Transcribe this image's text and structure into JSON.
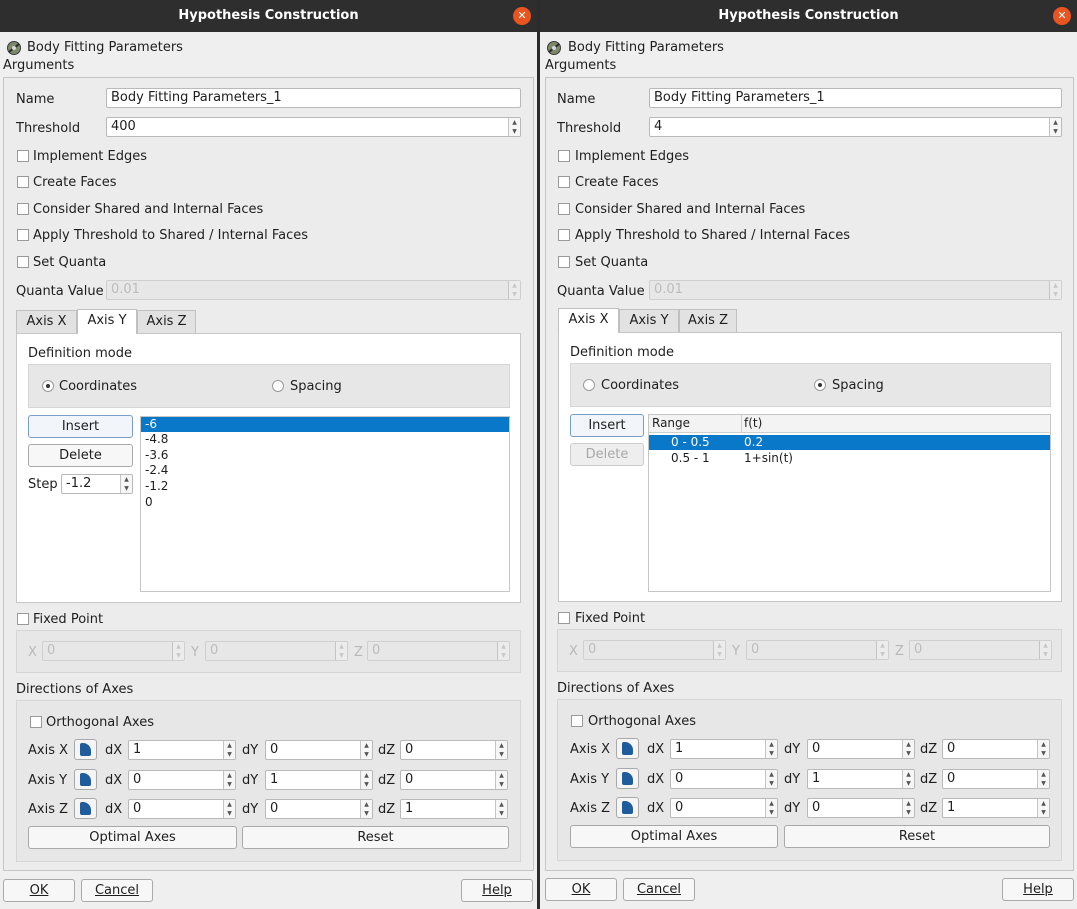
{
  "dialog_title": "Hypothesis Construction",
  "close_glyph": "✕",
  "header_label": "Body Fitting Parameters",
  "arguments_label": "Arguments",
  "name_label": "Name",
  "threshold_label": "Threshold",
  "implement_edges_label": "Implement Edges",
  "create_faces_label": "Create Faces",
  "consider_shared_label": "Consider Shared and Internal Faces",
  "apply_threshold_label": "Apply Threshold to Shared / Internal Faces",
  "set_quanta_label": "Set Quanta",
  "quanta_value_label": "Quanta Value",
  "tabs": [
    "Axis X",
    "Axis Y",
    "Axis Z"
  ],
  "definition_mode_label": "Definition mode",
  "coordinates_label": "Coordinates",
  "spacing_label": "Spacing",
  "insert_label": "Insert",
  "delete_label": "Delete",
  "step_label": "Step",
  "fixed_point_label": "Fixed Point",
  "x_label": "X",
  "y_label": "Y",
  "z_label": "Z",
  "directions_label": "Directions of Axes",
  "orthogonal_label": "Orthogonal Axes",
  "axis_rows": [
    "Axis X",
    "Axis Y",
    "Axis Z"
  ],
  "dx_label": "dX",
  "dy_label": "dY",
  "dz_label": "dZ",
  "optimal_axes_label": "Optimal Axes",
  "reset_label": "Reset",
  "ok_label": "OK",
  "cancel_label": "Cancel",
  "help_label": "Help",
  "left": {
    "name_value": "Body Fitting Parameters_1",
    "threshold_value": "400",
    "quanta_value": "0.01",
    "active_tab": "Axis Y",
    "definition_mode": "Coordinates",
    "step_value": "-1.2",
    "coordinates": [
      "-6",
      "-4.8",
      "-3.6",
      "-2.4",
      "-1.2",
      "0"
    ],
    "fixed_point": {
      "x": "0",
      "y": "0",
      "z": "0"
    },
    "axes": [
      {
        "dx": "1",
        "dy": "0",
        "dz": "0"
      },
      {
        "dx": "0",
        "dy": "1",
        "dz": "0"
      },
      {
        "dx": "0",
        "dy": "0",
        "dz": "1"
      }
    ]
  },
  "right": {
    "name_value": "Body Fitting Parameters_1",
    "threshold_value": "4",
    "quanta_value": "0.01",
    "active_tab": "Axis X",
    "definition_mode": "Spacing",
    "table_headers": [
      "Range",
      "f(t)"
    ],
    "spacing_rows": [
      {
        "range": "0 - 0.5",
        "ft": "0.2"
      },
      {
        "range": "0.5 - 1",
        "ft": "1+sin(t)"
      }
    ],
    "fixed_point": {
      "x": "0",
      "y": "0",
      "z": "0"
    },
    "axes": [
      {
        "dx": "1",
        "dy": "0",
        "dz": "0"
      },
      {
        "dx": "0",
        "dy": "1",
        "dz": "0"
      },
      {
        "dx": "0",
        "dy": "0",
        "dz": "1"
      }
    ]
  },
  "colors": {
    "titlebar": "#2e2e2e",
    "close_button": "#e95420",
    "selection": "#0a78c8",
    "dialog_bg": "#efefef"
  },
  "icons": [
    "hypothesis-icon",
    "close-icon",
    "axis-direction-icon",
    "spin-arrows-icon"
  ]
}
